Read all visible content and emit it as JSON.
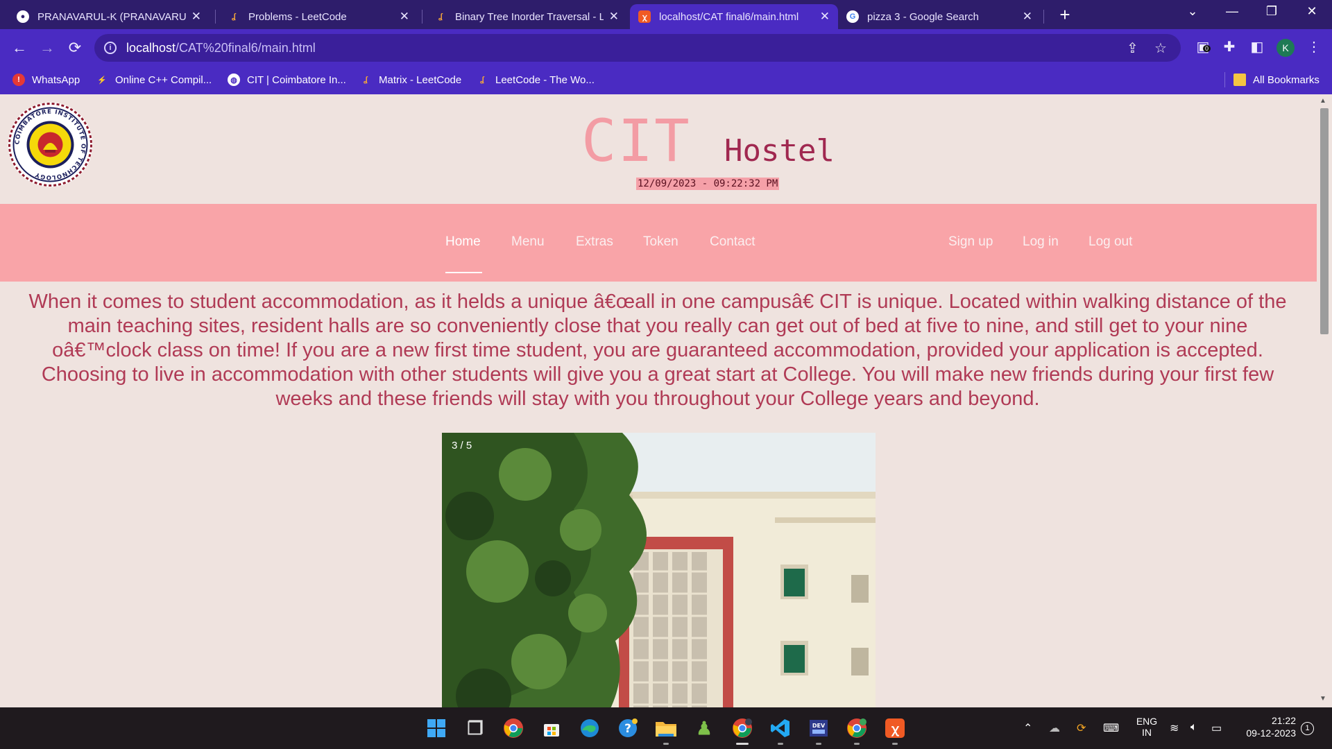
{
  "browser": {
    "tabs": [
      {
        "title": "PRANAVARUL-K (PRANAVARUL-K)",
        "icon": "github-icon",
        "active": false
      },
      {
        "title": "Problems - LeetCode",
        "icon": "leetcode-icon",
        "active": false
      },
      {
        "title": "Binary Tree Inorder Traversal - LeetCode",
        "icon": "leetcode-icon",
        "active": false
      },
      {
        "title": "localhost/CAT final6/main.html",
        "icon": "xampp-icon",
        "active": true
      },
      {
        "title": "pizza 3 - Google Search",
        "icon": "google-icon",
        "active": false
      }
    ],
    "url_host": "localhost",
    "url_path": "/CAT%20final6/main.html",
    "extension_badge": "0",
    "profile_initial": "K",
    "bookmarks": [
      {
        "label": "WhatsApp",
        "icon": "whatsapp-icon"
      },
      {
        "label": "Online C++ Compil...",
        "icon": "bolt-icon"
      },
      {
        "label": "CIT | Coimbatore In...",
        "icon": "globe-icon"
      },
      {
        "label": "Matrix - LeetCode",
        "icon": "leetcode-icon"
      },
      {
        "label": "LeetCode - The Wo...",
        "icon": "leetcode-icon"
      }
    ],
    "all_bookmarks_label": "All Bookmarks"
  },
  "page": {
    "title_main": "CIT",
    "title_sub": "Hostel",
    "datetime": "12/09/2023 - 09:22:32 PM",
    "nav_left": [
      "Home",
      "Menu",
      "Extras",
      "Token",
      "Contact"
    ],
    "nav_right": [
      "Sign up",
      "Log in",
      "Log out"
    ],
    "active_nav": "Home",
    "intro": "When it comes to student accommodation, as it helds a unique â€œall in one campusâ€ CIT is unique. Located within walking distance of the main teaching sites, resident halls are so conveniently close that you really can get out of bed at five to nine, and still get to your nine oâ€™clock class on time! If you are a new first time student, you are guaranteed accommodation, provided your application is accepted. Choosing to live in accommodation with other students will give you a great start at College. You will make new friends during your first few weeks and these friends will stay with you throughout your College years and beyond.",
    "slide_counter": "3 / 5",
    "logo_ring_text": "COIMBATORE INSTITUTE OF TECHNOLOGY"
  },
  "taskbar": {
    "apps": [
      "windows-start-icon",
      "task-view-icon",
      "chrome-icon",
      "microsoft-store-icon",
      "edge-icon",
      "help-icon",
      "file-explorer-icon",
      "chess-icon",
      "chrome-profile-k-icon",
      "vscode-icon",
      "dev-cpp-icon",
      "chrome-profile-p-icon",
      "xampp-icon"
    ],
    "language_line1": "ENG",
    "language_line2": "IN",
    "time": "21:22",
    "date": "09-12-2023",
    "notification_count": "1"
  },
  "colors": {
    "tabstrip": "#2e1d6b",
    "toolbar": "#4a2bc2",
    "page_bg": "#efe3df",
    "navbar": "#f9a4a8",
    "title_pink": "#f39ca4",
    "title_maroon": "#a02850",
    "intro_text": "#b03a55"
  }
}
